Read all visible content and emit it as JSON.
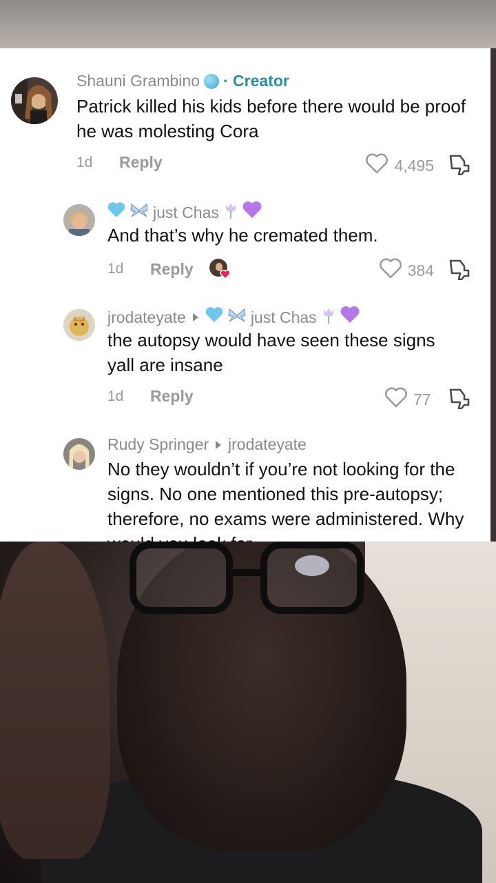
{
  "comments": [
    {
      "username": "Shauni Grambino",
      "badge_emoji": "globe-emoji",
      "creator_label": "· Creator",
      "text": "Patrick killed his kids before there would be proof he was molesting Cora",
      "time": "1d",
      "reply_label": "Reply",
      "likes": "4,495"
    },
    {
      "username": "just Chas",
      "text": "And that’s why he cremated them.",
      "time": "1d",
      "reply_label": "Reply",
      "likes": "384"
    },
    {
      "username": "jrodateyate",
      "reply_to": "just Chas",
      "text": "the autopsy would have seen these signs yall are insane",
      "time": "1d",
      "reply_label": "Reply",
      "likes": "77"
    },
    {
      "username": "Rudy Springer",
      "reply_to": "jrodateyate",
      "text": "No they wouldn’t if you’re not looking for the signs. No one mentioned this pre-autopsy; therefore, no exams were administered. Why would you look for"
    }
  ],
  "colors": {
    "creator_accent": "#2a8ea0",
    "meta_gray": "#9a9a9a",
    "text": "#111111",
    "heart_emoji": "#e8254b",
    "blue_heart": "#6ec6ef",
    "purple_heart": "#b678e8"
  },
  "icons": [
    "heart-outline-icon",
    "dislike-icon",
    "creator-liked-avatar",
    "play-arrow-icon"
  ]
}
